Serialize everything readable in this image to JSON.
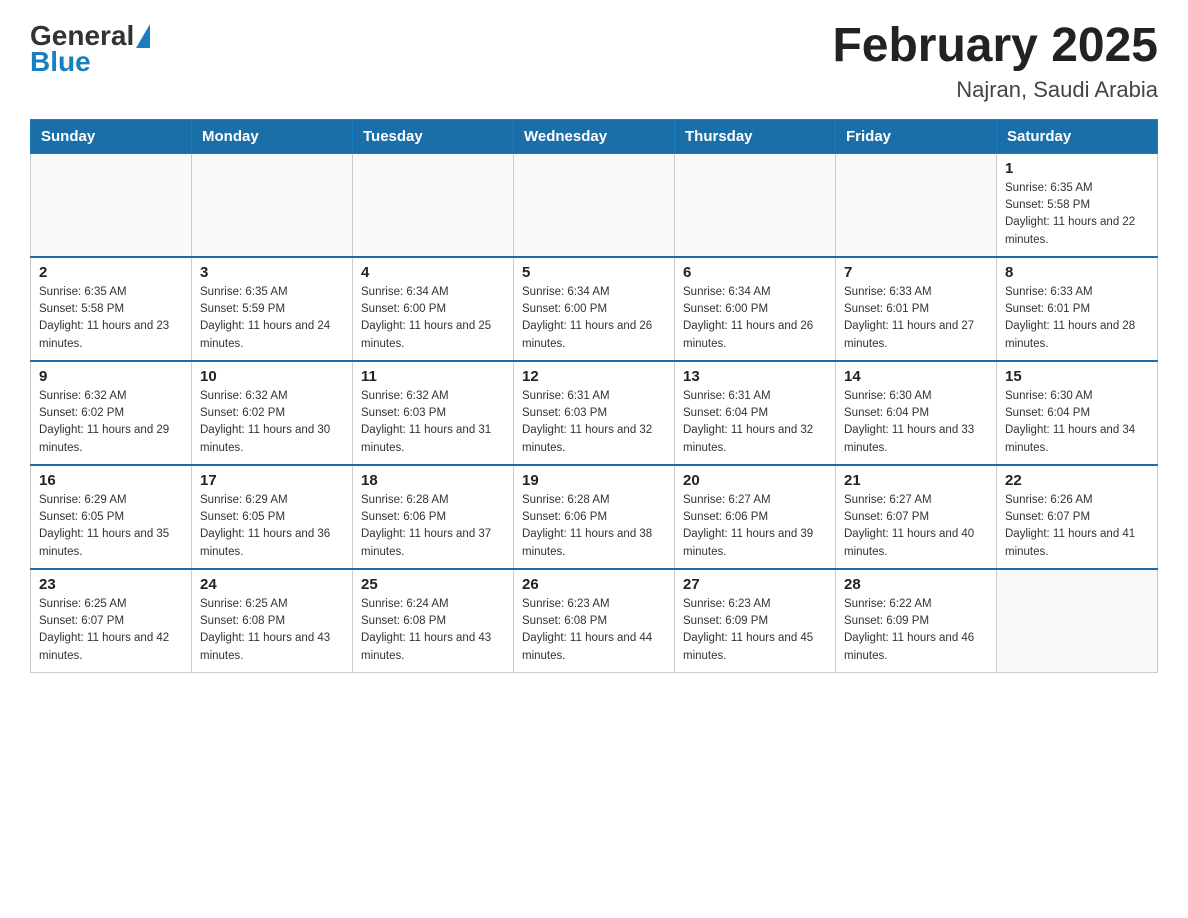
{
  "logo": {
    "general": "General",
    "triangle": "▶",
    "blue": "Blue"
  },
  "header": {
    "title": "February 2025",
    "location": "Najran, Saudi Arabia"
  },
  "days_of_week": [
    "Sunday",
    "Monday",
    "Tuesday",
    "Wednesday",
    "Thursday",
    "Friday",
    "Saturday"
  ],
  "weeks": [
    [
      {
        "day": "",
        "info": ""
      },
      {
        "day": "",
        "info": ""
      },
      {
        "day": "",
        "info": ""
      },
      {
        "day": "",
        "info": ""
      },
      {
        "day": "",
        "info": ""
      },
      {
        "day": "",
        "info": ""
      },
      {
        "day": "1",
        "info": "Sunrise: 6:35 AM\nSunset: 5:58 PM\nDaylight: 11 hours and 22 minutes."
      }
    ],
    [
      {
        "day": "2",
        "info": "Sunrise: 6:35 AM\nSunset: 5:58 PM\nDaylight: 11 hours and 23 minutes."
      },
      {
        "day": "3",
        "info": "Sunrise: 6:35 AM\nSunset: 5:59 PM\nDaylight: 11 hours and 24 minutes."
      },
      {
        "day": "4",
        "info": "Sunrise: 6:34 AM\nSunset: 6:00 PM\nDaylight: 11 hours and 25 minutes."
      },
      {
        "day": "5",
        "info": "Sunrise: 6:34 AM\nSunset: 6:00 PM\nDaylight: 11 hours and 26 minutes."
      },
      {
        "day": "6",
        "info": "Sunrise: 6:34 AM\nSunset: 6:00 PM\nDaylight: 11 hours and 26 minutes."
      },
      {
        "day": "7",
        "info": "Sunrise: 6:33 AM\nSunset: 6:01 PM\nDaylight: 11 hours and 27 minutes."
      },
      {
        "day": "8",
        "info": "Sunrise: 6:33 AM\nSunset: 6:01 PM\nDaylight: 11 hours and 28 minutes."
      }
    ],
    [
      {
        "day": "9",
        "info": "Sunrise: 6:32 AM\nSunset: 6:02 PM\nDaylight: 11 hours and 29 minutes."
      },
      {
        "day": "10",
        "info": "Sunrise: 6:32 AM\nSunset: 6:02 PM\nDaylight: 11 hours and 30 minutes."
      },
      {
        "day": "11",
        "info": "Sunrise: 6:32 AM\nSunset: 6:03 PM\nDaylight: 11 hours and 31 minutes."
      },
      {
        "day": "12",
        "info": "Sunrise: 6:31 AM\nSunset: 6:03 PM\nDaylight: 11 hours and 32 minutes."
      },
      {
        "day": "13",
        "info": "Sunrise: 6:31 AM\nSunset: 6:04 PM\nDaylight: 11 hours and 32 minutes."
      },
      {
        "day": "14",
        "info": "Sunrise: 6:30 AM\nSunset: 6:04 PM\nDaylight: 11 hours and 33 minutes."
      },
      {
        "day": "15",
        "info": "Sunrise: 6:30 AM\nSunset: 6:04 PM\nDaylight: 11 hours and 34 minutes."
      }
    ],
    [
      {
        "day": "16",
        "info": "Sunrise: 6:29 AM\nSunset: 6:05 PM\nDaylight: 11 hours and 35 minutes."
      },
      {
        "day": "17",
        "info": "Sunrise: 6:29 AM\nSunset: 6:05 PM\nDaylight: 11 hours and 36 minutes."
      },
      {
        "day": "18",
        "info": "Sunrise: 6:28 AM\nSunset: 6:06 PM\nDaylight: 11 hours and 37 minutes."
      },
      {
        "day": "19",
        "info": "Sunrise: 6:28 AM\nSunset: 6:06 PM\nDaylight: 11 hours and 38 minutes."
      },
      {
        "day": "20",
        "info": "Sunrise: 6:27 AM\nSunset: 6:06 PM\nDaylight: 11 hours and 39 minutes."
      },
      {
        "day": "21",
        "info": "Sunrise: 6:27 AM\nSunset: 6:07 PM\nDaylight: 11 hours and 40 minutes."
      },
      {
        "day": "22",
        "info": "Sunrise: 6:26 AM\nSunset: 6:07 PM\nDaylight: 11 hours and 41 minutes."
      }
    ],
    [
      {
        "day": "23",
        "info": "Sunrise: 6:25 AM\nSunset: 6:07 PM\nDaylight: 11 hours and 42 minutes."
      },
      {
        "day": "24",
        "info": "Sunrise: 6:25 AM\nSunset: 6:08 PM\nDaylight: 11 hours and 43 minutes."
      },
      {
        "day": "25",
        "info": "Sunrise: 6:24 AM\nSunset: 6:08 PM\nDaylight: 11 hours and 43 minutes."
      },
      {
        "day": "26",
        "info": "Sunrise: 6:23 AM\nSunset: 6:08 PM\nDaylight: 11 hours and 44 minutes."
      },
      {
        "day": "27",
        "info": "Sunrise: 6:23 AM\nSunset: 6:09 PM\nDaylight: 11 hours and 45 minutes."
      },
      {
        "day": "28",
        "info": "Sunrise: 6:22 AM\nSunset: 6:09 PM\nDaylight: 11 hours and 46 minutes."
      },
      {
        "day": "",
        "info": ""
      }
    ]
  ]
}
